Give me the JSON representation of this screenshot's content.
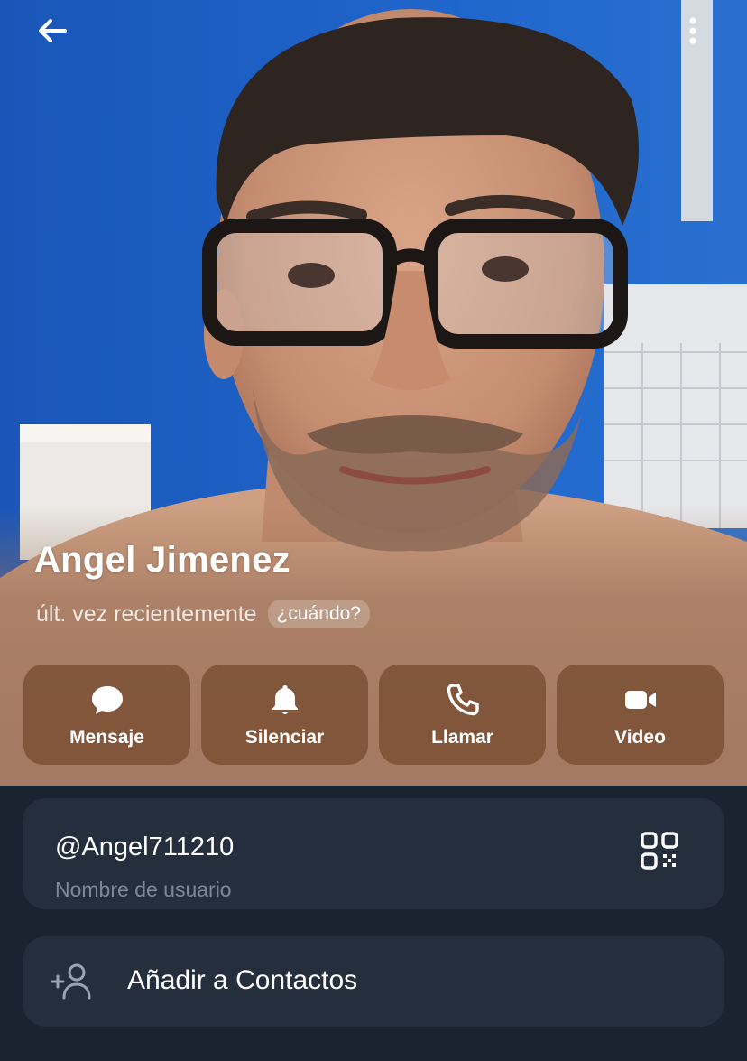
{
  "header": {
    "back_icon": "arrow-left-icon",
    "menu_icon": "more-vertical-icon"
  },
  "profile": {
    "name": "Angel Jimenez",
    "status": "últ. vez recientemente",
    "when_chip": "¿cuándo?"
  },
  "actions": [
    {
      "label": "Mensaje",
      "icon": "chat-bubble-icon"
    },
    {
      "label": "Silenciar",
      "icon": "bell-icon"
    },
    {
      "label": "Llamar",
      "icon": "phone-icon"
    },
    {
      "label": "Video",
      "icon": "video-camera-icon"
    }
  ],
  "info": {
    "username": "@Angel711210",
    "username_caption": "Nombre de usuario",
    "qr_icon": "qr-code-icon"
  },
  "add_contact": {
    "label": "Añadir a Contactos",
    "icon": "add-person-icon"
  },
  "colors": {
    "wall_blue": "#1d5fc0",
    "panel_bg": "#1b2330",
    "card_bg": "#252e3c",
    "action_bg": "#73482d",
    "caption_gray": "#7d8797"
  }
}
